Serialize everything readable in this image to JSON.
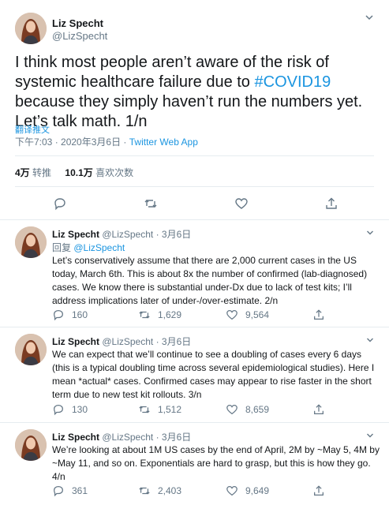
{
  "main_tweet": {
    "name": "Liz Specht",
    "handle": "@LizSpecht",
    "text_before": "I think most people aren’t aware of the risk of systemic healthcare failure due to ",
    "hashtag": "#COVID19",
    "text_after": " because they simply haven’t run the numbers yet. Let’s talk math. 1/n",
    "translate_label": "翻译推文",
    "timestamp": "下午7:03 · 2020年3月6日 · ",
    "app": "Twitter Web App",
    "retweets_count": "4万",
    "retweets_label": "转推",
    "likes_count": "10.1万",
    "likes_label": "喜欢次数"
  },
  "replies": [
    {
      "name": "Liz Specht",
      "meta": "@LizSpecht · 3月6日",
      "replying_to_label": "回复 ",
      "replying_to_handle": "@LizSpecht",
      "text": "Let’s conservatively assume that there are 2,000 current cases in the US today, March 6th. This is about 8x the number of confirmed (lab-diagnosed) cases. We know there is substantial under-Dx due to lack of test kits; I’ll address implications later of under-/over-estimate. 2/n",
      "reply_count": "160",
      "retweet_count": "1,629",
      "like_count": "9,564"
    },
    {
      "name": "Liz Specht",
      "meta": "@LizSpecht · 3月6日",
      "text": "We can expect that we’ll continue to see a doubling of cases every 6 days (this is a typical doubling time across several epidemiological studies). Here I mean *actual* cases. Confirmed cases may appear to rise faster in the short term due to new test kit rollouts. 3/n",
      "reply_count": "130",
      "retweet_count": "1,512",
      "like_count": "8,659"
    },
    {
      "name": "Liz Specht",
      "meta": "@LizSpecht · 3月6日",
      "text": "We’re looking at about 1M US cases by the end of April, 2M by ~May 5, 4M by ~May 11, and so on. Exponentials are hard to grasp, but this is how they go. 4/n",
      "reply_count": "361",
      "retweet_count": "2,403",
      "like_count": "9,649"
    }
  ],
  "colors": {
    "link": "#1b95e0",
    "muted": "#657786",
    "text": "#14171a",
    "divider": "#e6ecf0"
  },
  "icons": [
    "avatar",
    "chevron-down-icon",
    "reply-icon",
    "retweet-icon",
    "like-icon",
    "share-icon"
  ]
}
